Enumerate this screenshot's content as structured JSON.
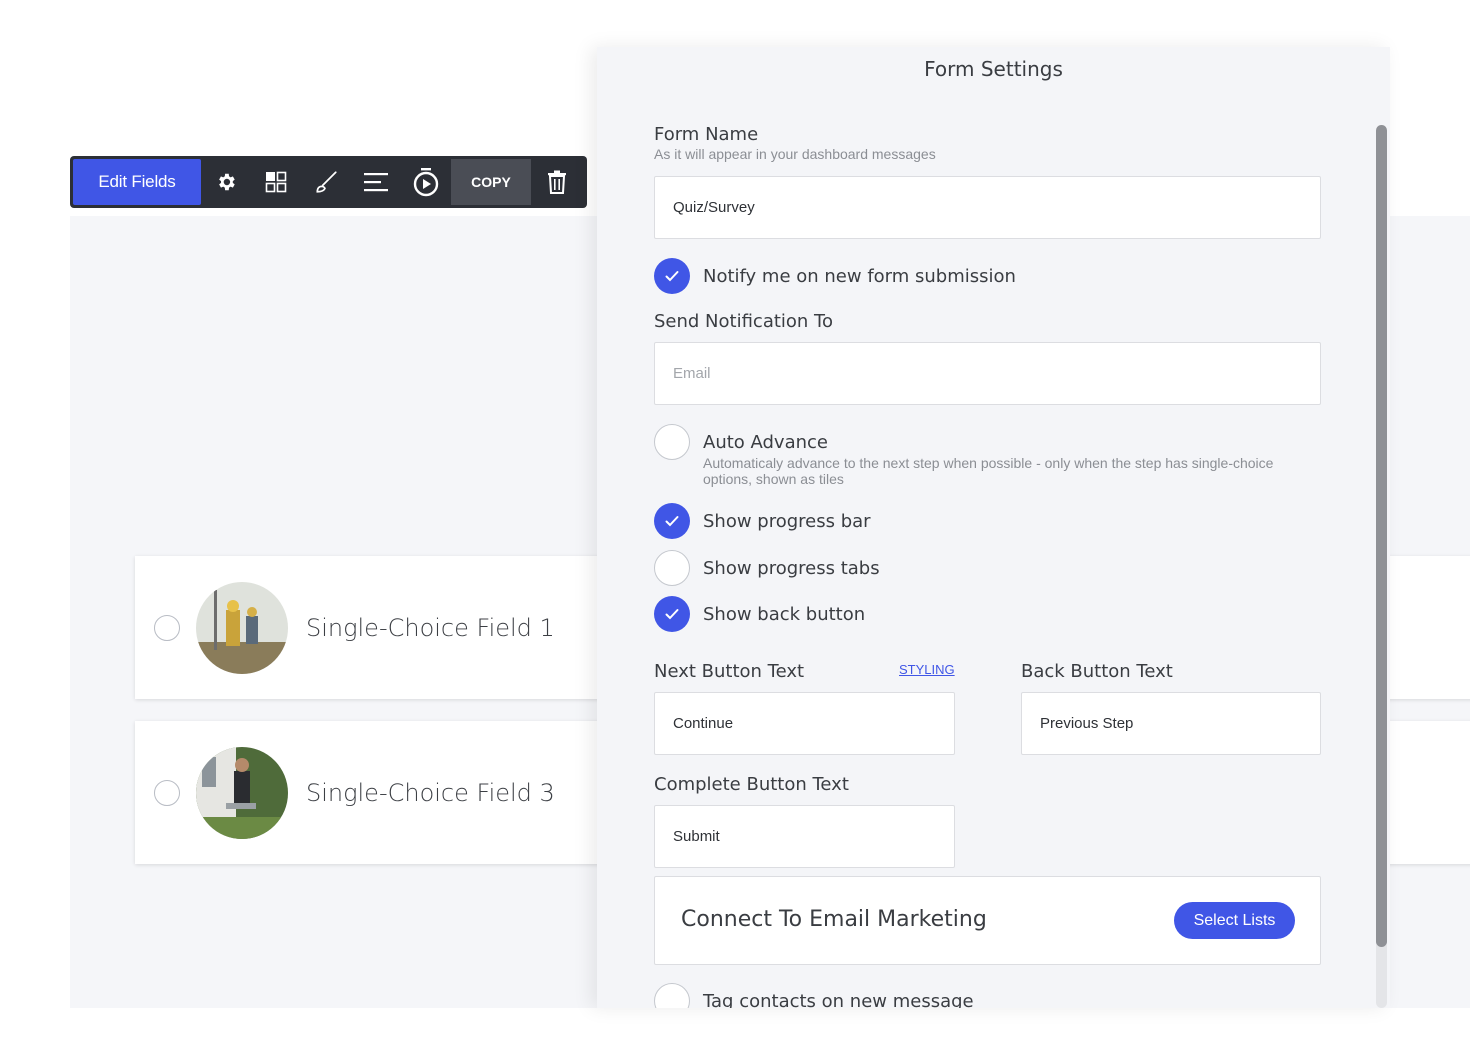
{
  "toolbar": {
    "edit_label": "Edit Fields",
    "copy_label": "COPY",
    "icons": [
      "gear-icon",
      "layout-icon",
      "brush-icon",
      "align-icon",
      "timer-icon",
      "trash-icon"
    ]
  },
  "choices": [
    {
      "label": "Single-Choice Field 1"
    },
    {
      "label": "Single-Choice Field 3"
    }
  ],
  "panel": {
    "title": "Form Settings",
    "form_name": {
      "label": "Form Name",
      "hint": "As it will appear in your dashboard messages",
      "value": "Quiz/Survey"
    },
    "notify": {
      "label": "Notify me on new form submission",
      "checked": true
    },
    "send_to": {
      "label": "Send Notification To",
      "placeholder": "Email"
    },
    "auto_advance": {
      "label": "Auto Advance",
      "hint": "Automaticaly advance to the next step when possible - only when the step has single-choice options, shown as tiles",
      "checked": false
    },
    "progress_bar": {
      "label": "Show progress bar",
      "checked": true
    },
    "progress_tabs": {
      "label": "Show progress tabs",
      "checked": false
    },
    "back_button": {
      "label": "Show back button",
      "checked": true
    },
    "next_text": {
      "label": "Next Button Text",
      "styling_link": "STYLING",
      "value": "Continue"
    },
    "back_text": {
      "label": "Back Button Text",
      "value": "Previous Step"
    },
    "complete_text": {
      "label": "Complete Button Text",
      "value": "Submit"
    },
    "email_marketing": {
      "title": "Connect To Email Marketing",
      "button": "Select Lists"
    },
    "tag_contacts": {
      "label": "Tag contacts on new message",
      "checked": false
    }
  },
  "colors": {
    "accent": "#4056e6",
    "toolbar": "#2c2f36"
  }
}
